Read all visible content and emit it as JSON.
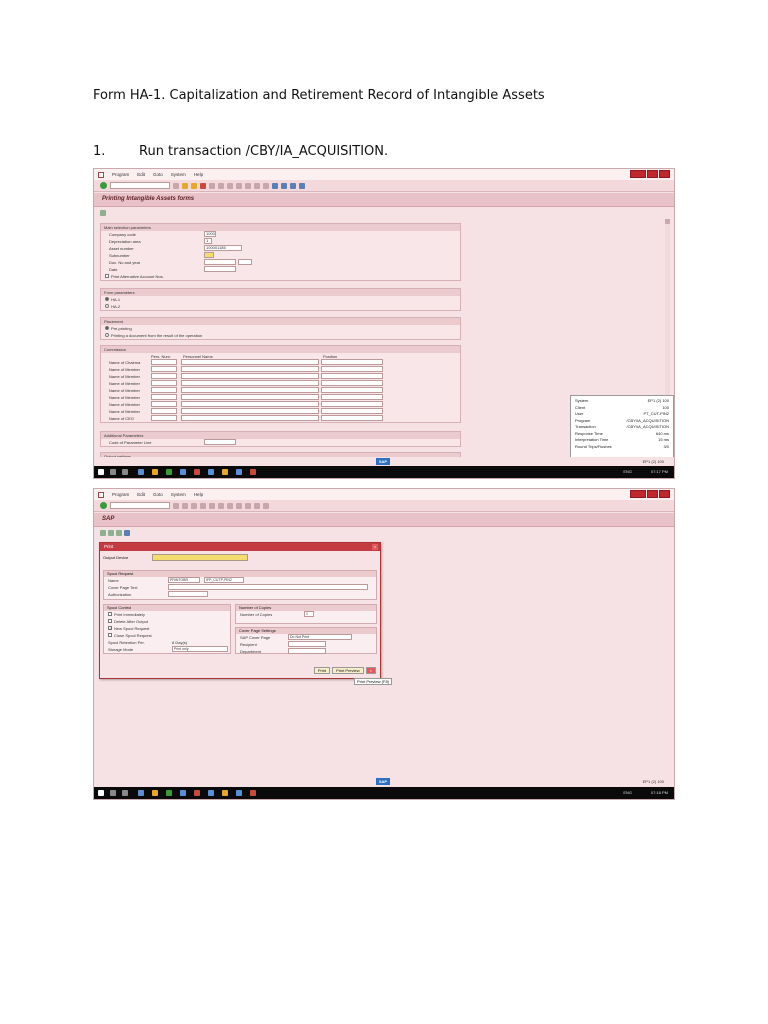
{
  "doc": {
    "title": "Form HA-1. Capitalization and Retirement Record of Intangible Assets",
    "step_num": "1.",
    "step_text": "Run transaction /CBY/IA_ACQUISITION."
  },
  "menu": [
    "Program",
    "Edit",
    "Goto",
    "System",
    "Help"
  ],
  "screen1": {
    "title": "Printing Intangible Assets forms",
    "main_group": "Main selection parameters",
    "fields": [
      {
        "label": "Company code",
        "value": "1000"
      },
      {
        "label": "Depreciation area",
        "value": "1"
      },
      {
        "label": "Asset number",
        "value": "100001185"
      },
      {
        "label": "Subnumber",
        "value": ""
      },
      {
        "label": "Doc. No and year",
        "value": ""
      },
      {
        "label": "Date",
        "value": ""
      }
    ],
    "print_alt": "Print Alternative Account Nos.",
    "form_group": "Form parameters",
    "form_options": [
      "HA-1",
      "HA-2"
    ],
    "placement_group": "Placement",
    "placement_options": [
      "Pre-printing",
      "Printing a document from the result of the operation"
    ],
    "commission_group": "Commission",
    "commission_cols": [
      "Pers. Num.",
      "Personnel Name",
      "Position"
    ],
    "commission_rows": [
      "Name of Chairma",
      "Name of Member",
      "Name of Member",
      "Name of Member",
      "Name of Member",
      "Name of Member",
      "Name of Member",
      "Name of Member",
      "Name of CEO"
    ],
    "additional_group": "Additional Parameters",
    "parameter_label": "Code of Parameter Line",
    "output_group": "Output settings",
    "system_info": [
      {
        "label": "System",
        "value": "EP1 (2) 100"
      },
      {
        "label": "Client",
        "value": "100"
      },
      {
        "label": "User",
        "value": "PT_CUT-PIN2"
      },
      {
        "label": "Program",
        "value": "/CBY/IA_ACQUISITION"
      },
      {
        "label": "Transaction",
        "value": "/CBY/IA_ACQUISITION"
      },
      {
        "label": "Response Time",
        "value": "640 ms"
      },
      {
        "label": "Interpretation Time",
        "value": "15 ms"
      },
      {
        "label": "Round Trips/Flushes",
        "value": "3/0"
      }
    ],
    "status_sys": "EP1 (2) 100",
    "clock": "07:17 PM",
    "lang": "ENG"
  },
  "screen2": {
    "title": "SAP",
    "dialog_title": "Print",
    "output_device": "Output Device",
    "spool_request": "Spool Request",
    "name_label": "Name",
    "name_value1": "PRINTOBR",
    "name_value2": "IFP_CUTP-PIN2",
    "cover_text": "Cover Page Text",
    "authorization": "Authorization",
    "spool_control": "Spool Control",
    "spool_items": [
      {
        "label": "Print Immediately",
        "checked": ""
      },
      {
        "label": "Delete After Output",
        "checked": ""
      },
      {
        "label": "New Spool Request",
        "checked": "✓"
      },
      {
        "label": "Close Spool Request",
        "checked": ""
      }
    ],
    "retention_label": "Spool Retention Per.",
    "retention_value": "8 Day(s)",
    "storage_label": "Storage Mode",
    "storage_value": "Print only",
    "copies_group": "Number of Copies",
    "copies_label": "Number of Copies",
    "copies_value": "1",
    "cover_group": "Cover Page Settings",
    "sap_cover_label": "SAP Cover Page",
    "sap_cover_value": "Do Not Print",
    "recipient_label": "Recipient",
    "department_label": "Department",
    "btn_print": "Print",
    "btn_preview": "Print Preview",
    "tooltip": "Print Preview (F8)",
    "status_sys": "EP1 (2) 100",
    "clock": "07:18 PM",
    "lang": "ENG"
  }
}
